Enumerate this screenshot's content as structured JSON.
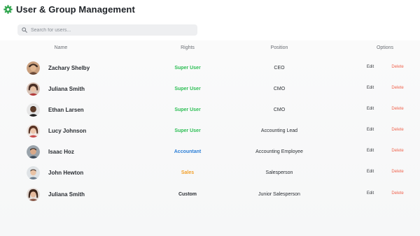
{
  "app": {
    "title": "User & Group Management",
    "icon": "gear-icon"
  },
  "search": {
    "placeholder": "Search for users...",
    "value": ""
  },
  "table": {
    "headers": {
      "name": "Name",
      "rights": "Rights",
      "position": "Position",
      "options": "Options"
    },
    "edit_label": "Edit",
    "delete_label": "Delete",
    "rows": [
      {
        "name": "Zachary Shelby",
        "rights": "Super User",
        "position": "CEO"
      },
      {
        "name": "Juliana Smith",
        "rights": "Super User",
        "position": "CMO"
      },
      {
        "name": "Ethan Larsen",
        "rights": "Super User",
        "position": "CMO"
      },
      {
        "name": "Lucy Johnson",
        "rights": "Super User",
        "position": "Accounting Lead"
      },
      {
        "name": "Isaac Hoz",
        "rights": "Accountant",
        "position": "Accounting Employee"
      },
      {
        "name": "John Hewton",
        "rights": "Sales",
        "position": "Salesperson"
      },
      {
        "name": "Juliana Smith",
        "rights": "Custom",
        "position": "Junior Salesperson"
      }
    ]
  },
  "colors": {
    "brand": "#2ea54c",
    "super_user": "#2dbf55",
    "accountant": "#2f80d8",
    "sales": "#f2a12c",
    "custom": "#2a2e33",
    "delete": "#f0654f"
  }
}
